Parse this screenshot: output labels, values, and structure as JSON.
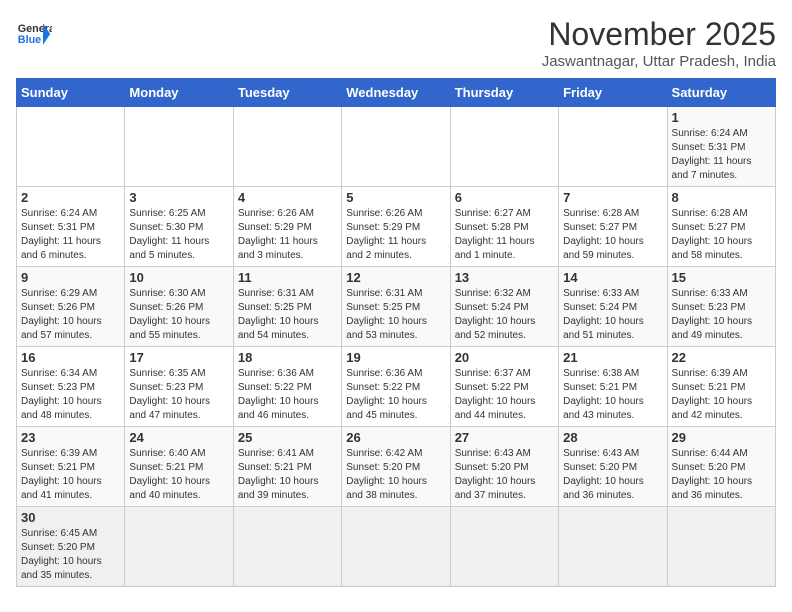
{
  "header": {
    "logo_general": "General",
    "logo_blue": "Blue",
    "month_year": "November 2025",
    "location": "Jaswantnagar, Uttar Pradesh, India"
  },
  "days_of_week": [
    "Sunday",
    "Monday",
    "Tuesday",
    "Wednesday",
    "Thursday",
    "Friday",
    "Saturday"
  ],
  "weeks": [
    [
      {
        "day": "",
        "info": ""
      },
      {
        "day": "",
        "info": ""
      },
      {
        "day": "",
        "info": ""
      },
      {
        "day": "",
        "info": ""
      },
      {
        "day": "",
        "info": ""
      },
      {
        "day": "",
        "info": ""
      },
      {
        "day": "1",
        "info": "Sunrise: 6:24 AM\nSunset: 5:31 PM\nDaylight: 11 hours\nand 7 minutes."
      }
    ],
    [
      {
        "day": "2",
        "info": "Sunrise: 6:24 AM\nSunset: 5:31 PM\nDaylight: 11 hours\nand 6 minutes."
      },
      {
        "day": "3",
        "info": "Sunrise: 6:25 AM\nSunset: 5:30 PM\nDaylight: 11 hours\nand 5 minutes."
      },
      {
        "day": "4",
        "info": "Sunrise: 6:26 AM\nSunset: 5:29 PM\nDaylight: 11 hours\nand 3 minutes."
      },
      {
        "day": "5",
        "info": "Sunrise: 6:26 AM\nSunset: 5:29 PM\nDaylight: 11 hours\nand 2 minutes."
      },
      {
        "day": "6",
        "info": "Sunrise: 6:27 AM\nSunset: 5:28 PM\nDaylight: 11 hours\nand 1 minute."
      },
      {
        "day": "7",
        "info": "Sunrise: 6:28 AM\nSunset: 5:27 PM\nDaylight: 10 hours\nand 59 minutes."
      },
      {
        "day": "8",
        "info": "Sunrise: 6:28 AM\nSunset: 5:27 PM\nDaylight: 10 hours\nand 58 minutes."
      }
    ],
    [
      {
        "day": "9",
        "info": "Sunrise: 6:29 AM\nSunset: 5:26 PM\nDaylight: 10 hours\nand 57 minutes."
      },
      {
        "day": "10",
        "info": "Sunrise: 6:30 AM\nSunset: 5:26 PM\nDaylight: 10 hours\nand 55 minutes."
      },
      {
        "day": "11",
        "info": "Sunrise: 6:31 AM\nSunset: 5:25 PM\nDaylight: 10 hours\nand 54 minutes."
      },
      {
        "day": "12",
        "info": "Sunrise: 6:31 AM\nSunset: 5:25 PM\nDaylight: 10 hours\nand 53 minutes."
      },
      {
        "day": "13",
        "info": "Sunrise: 6:32 AM\nSunset: 5:24 PM\nDaylight: 10 hours\nand 52 minutes."
      },
      {
        "day": "14",
        "info": "Sunrise: 6:33 AM\nSunset: 5:24 PM\nDaylight: 10 hours\nand 51 minutes."
      },
      {
        "day": "15",
        "info": "Sunrise: 6:33 AM\nSunset: 5:23 PM\nDaylight: 10 hours\nand 49 minutes."
      }
    ],
    [
      {
        "day": "16",
        "info": "Sunrise: 6:34 AM\nSunset: 5:23 PM\nDaylight: 10 hours\nand 48 minutes."
      },
      {
        "day": "17",
        "info": "Sunrise: 6:35 AM\nSunset: 5:23 PM\nDaylight: 10 hours\nand 47 minutes."
      },
      {
        "day": "18",
        "info": "Sunrise: 6:36 AM\nSunset: 5:22 PM\nDaylight: 10 hours\nand 46 minutes."
      },
      {
        "day": "19",
        "info": "Sunrise: 6:36 AM\nSunset: 5:22 PM\nDaylight: 10 hours\nand 45 minutes."
      },
      {
        "day": "20",
        "info": "Sunrise: 6:37 AM\nSunset: 5:22 PM\nDaylight: 10 hours\nand 44 minutes."
      },
      {
        "day": "21",
        "info": "Sunrise: 6:38 AM\nSunset: 5:21 PM\nDaylight: 10 hours\nand 43 minutes."
      },
      {
        "day": "22",
        "info": "Sunrise: 6:39 AM\nSunset: 5:21 PM\nDaylight: 10 hours\nand 42 minutes."
      }
    ],
    [
      {
        "day": "23",
        "info": "Sunrise: 6:39 AM\nSunset: 5:21 PM\nDaylight: 10 hours\nand 41 minutes."
      },
      {
        "day": "24",
        "info": "Sunrise: 6:40 AM\nSunset: 5:21 PM\nDaylight: 10 hours\nand 40 minutes."
      },
      {
        "day": "25",
        "info": "Sunrise: 6:41 AM\nSunset: 5:21 PM\nDaylight: 10 hours\nand 39 minutes."
      },
      {
        "day": "26",
        "info": "Sunrise: 6:42 AM\nSunset: 5:20 PM\nDaylight: 10 hours\nand 38 minutes."
      },
      {
        "day": "27",
        "info": "Sunrise: 6:43 AM\nSunset: 5:20 PM\nDaylight: 10 hours\nand 37 minutes."
      },
      {
        "day": "28",
        "info": "Sunrise: 6:43 AM\nSunset: 5:20 PM\nDaylight: 10 hours\nand 36 minutes."
      },
      {
        "day": "29",
        "info": "Sunrise: 6:44 AM\nSunset: 5:20 PM\nDaylight: 10 hours\nand 36 minutes."
      }
    ],
    [
      {
        "day": "30",
        "info": "Sunrise: 6:45 AM\nSunset: 5:20 PM\nDaylight: 10 hours\nand 35 minutes."
      },
      {
        "day": "",
        "info": ""
      },
      {
        "day": "",
        "info": ""
      },
      {
        "day": "",
        "info": ""
      },
      {
        "day": "",
        "info": ""
      },
      {
        "day": "",
        "info": ""
      },
      {
        "day": "",
        "info": ""
      }
    ]
  ]
}
